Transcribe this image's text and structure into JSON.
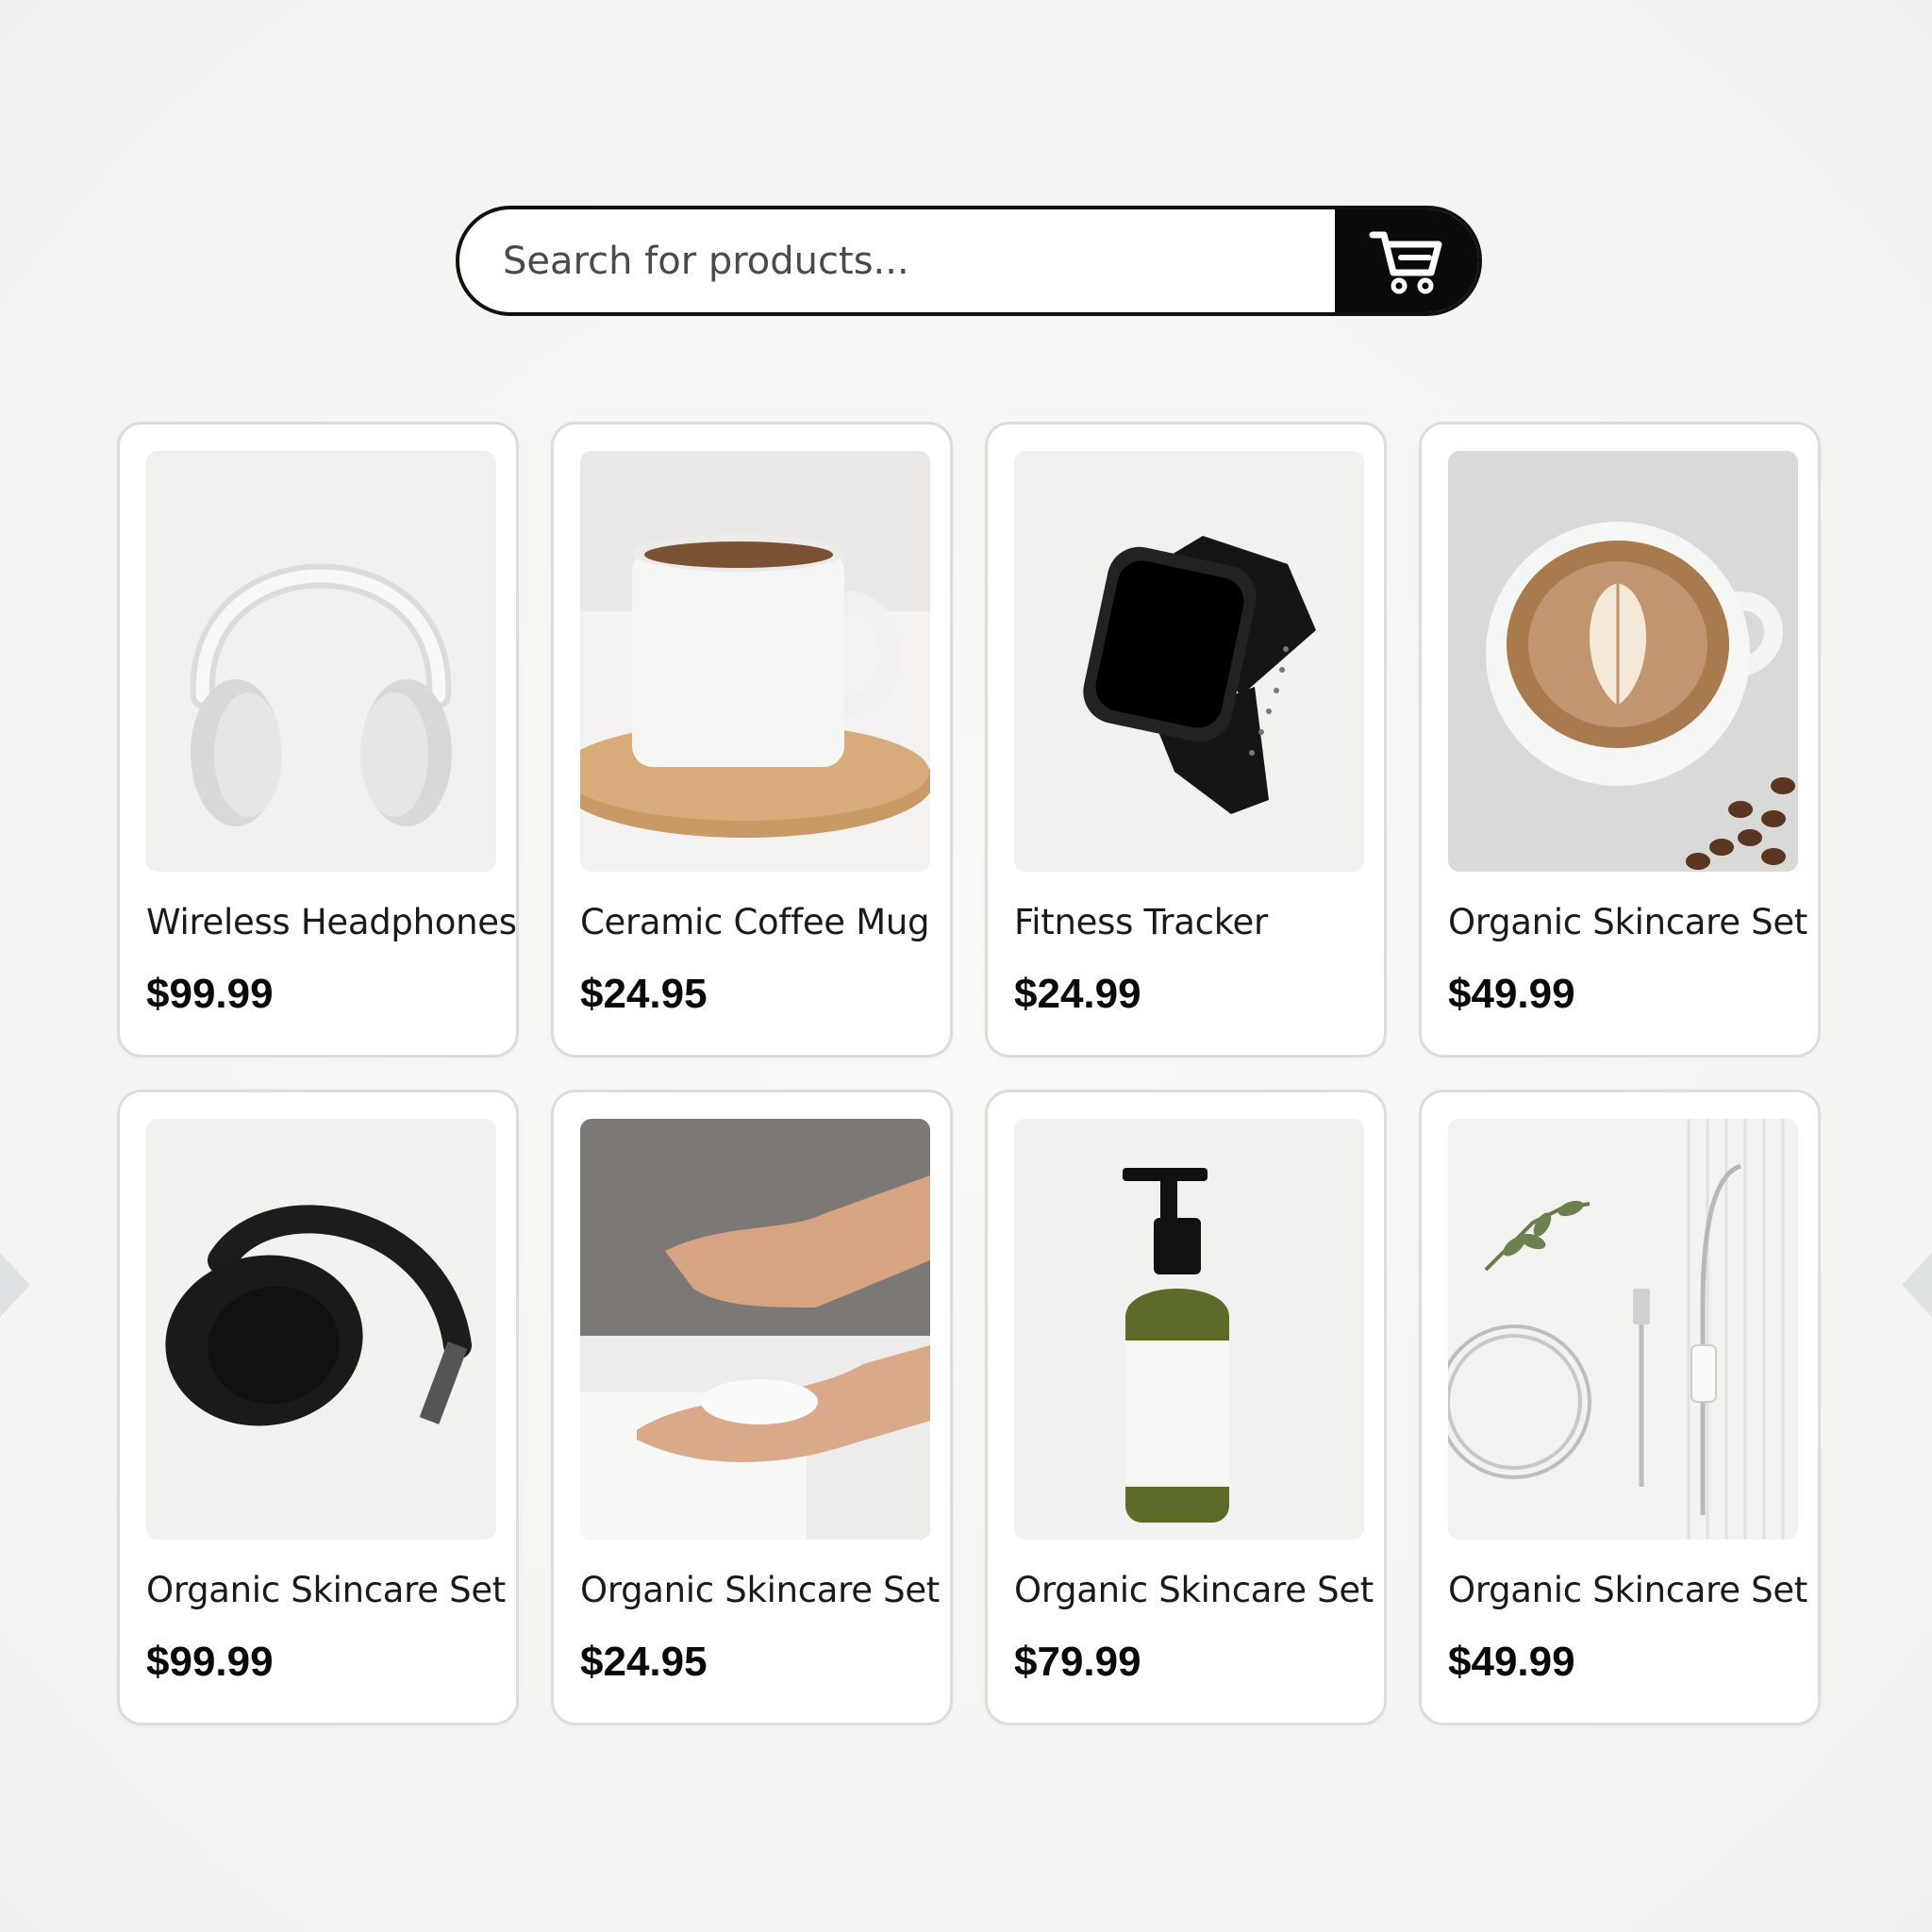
{
  "search": {
    "placeholder": "Search for products..."
  },
  "cart_icon": "shopping-cart-icon",
  "products": [
    {
      "name": "Wireless Headphones",
      "price": "$99.99",
      "image": "white-headphones"
    },
    {
      "name": "Ceramic Coffee Mug",
      "price": "$24.95",
      "image": "coffee-mug"
    },
    {
      "name": "Fitness Tracker",
      "price": "$24.99",
      "image": "smartwatch"
    },
    {
      "name": "Organic Skincare Set",
      "price": "$49.99",
      "image": "latte-cup"
    },
    {
      "name": "Organic Skincare Set",
      "price": "$99.99",
      "image": "black-headphones"
    },
    {
      "name": "Organic Skincare Set",
      "price": "$24.95",
      "image": "hands-powder"
    },
    {
      "name": "Organic Skincare Set",
      "price": "$79.99",
      "image": "pump-bottle"
    },
    {
      "name": "Organic Skincare Set",
      "price": "$49.99",
      "image": "usb-cable"
    }
  ],
  "colors": {
    "accent": "#0a0a0a",
    "card_border": "#dcdcdc",
    "page_bg": "#f4f4f2"
  }
}
